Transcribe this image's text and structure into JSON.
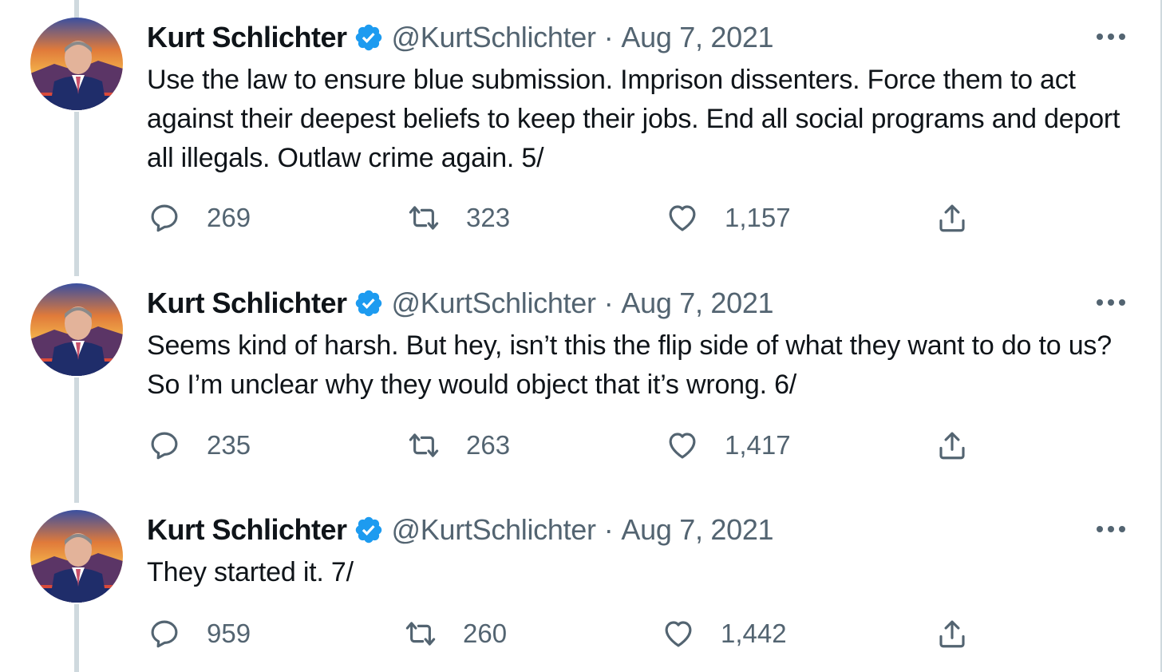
{
  "tweets": [
    {
      "name": "Kurt Schlichter",
      "handle": "@KurtSchlichter",
      "separator": "·",
      "date": "Aug 7, 2021",
      "text": "Use the law to ensure blue submission. Imprison dissenters. Force them to act against their deepest beliefs to keep their jobs. End all social programs and deport all illegals. Outlaw crime again. 5/",
      "replies": "269",
      "retweets": "323",
      "likes": "1,157"
    },
    {
      "name": "Kurt Schlichter",
      "handle": "@KurtSchlichter",
      "separator": "·",
      "date": "Aug 7, 2021",
      "text": "Seems kind of harsh. But hey, isn’t this the flip side of what they want to do to us? So I’m unclear why they would object that it’s wrong. 6/",
      "replies": "235",
      "retweets": "263",
      "likes": "1,417"
    },
    {
      "name": "Kurt Schlichter",
      "handle": "@KurtSchlichter",
      "separator": "·",
      "date": "Aug 7, 2021",
      "text": "They started it. 7/",
      "replies": "959",
      "retweets": "260",
      "likes": "1,442"
    }
  ],
  "colors": {
    "verified": "#1d9bf0",
    "secondary_text": "#536471",
    "primary_text": "#0f1419",
    "thread_line": "#cfd9de"
  },
  "icons": [
    "verified-badge-icon",
    "more-options-icon",
    "reply-icon",
    "retweet-icon",
    "like-icon",
    "share-icon"
  ]
}
